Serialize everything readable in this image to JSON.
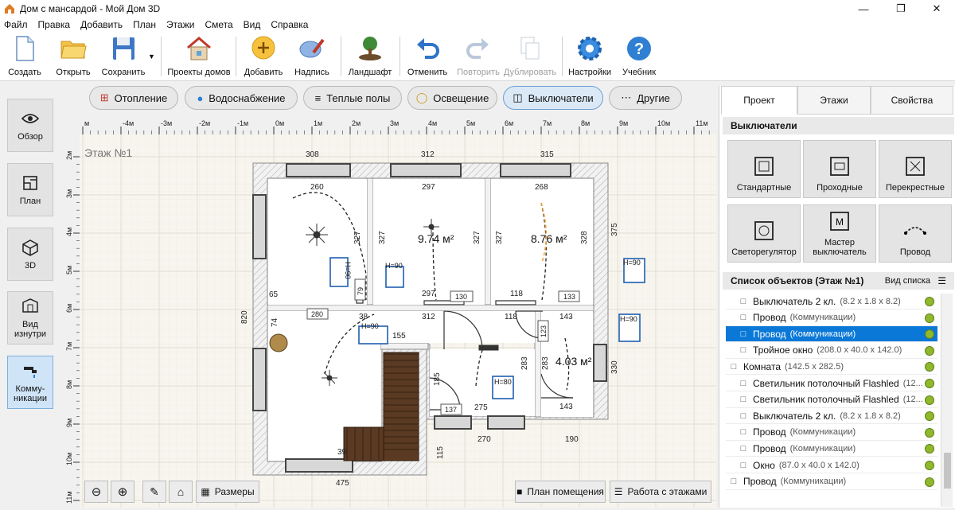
{
  "window": {
    "title": "Дом с мансардой - Мой Дом 3D"
  },
  "menu": [
    "Файл",
    "Правка",
    "Добавить",
    "План",
    "Этажи",
    "Смета",
    "Вид",
    "Справка"
  ],
  "toolbar": {
    "create": "Создать",
    "open": "Открыть",
    "save": "Сохранить",
    "projects": "Проекты домов",
    "add": "Добавить",
    "label": "Надпись",
    "landscape": "Ландшафт",
    "undo": "Отменить",
    "redo": "Повторить",
    "duplicate": "Дублировать",
    "settings": "Настройки",
    "tutorial": "Учебник"
  },
  "left_nav": {
    "overview": "Обзор",
    "plan": "План",
    "3d": "3D",
    "inside_view": "Вид изнутри",
    "communications": "Комму-никации"
  },
  "categories": {
    "heating": "Отопление",
    "water": "Водоснабжение",
    "floors": "Теплые полы",
    "lighting": "Освещение",
    "switches": "Выключатели",
    "other": "Другие"
  },
  "ruler": {
    "x_labels": [
      "м",
      "-4м",
      "-3м",
      "-2м",
      "-1м",
      "0м",
      "1м",
      "2м",
      "3м",
      "4м",
      "5м",
      "6м",
      "7м",
      "8м",
      "9м",
      "10м",
      "11м"
    ],
    "y_labels": [
      "2м",
      "3м",
      "4м",
      "5м",
      "6м",
      "7м",
      "8м",
      "9м",
      "10м",
      "11м"
    ]
  },
  "plan": {
    "floor_label": "Этаж №1",
    "dims": {
      "top1": "308",
      "top2": "312",
      "top3": "315",
      "left": "820",
      "right": "375",
      "right2": "330",
      "bottom1": "475",
      "bottom2": "270",
      "bottom3": "190",
      "r260": "260",
      "r297a": "297",
      "r268": "268",
      "v327a": "327",
      "v327b": "327",
      "v327c": "327",
      "v328": "328",
      "area1": "9.74 м²",
      "area2": "8.76 м²",
      "area3": "4.03 м²",
      "d297b": "297",
      "d130": "130",
      "d118": "118",
      "d133": "133",
      "d65": "65",
      "d280": "280",
      "d38": "38",
      "d312": "312",
      "d118b": "118",
      "d143a": "143",
      "d143b": "143",
      "d123": "123",
      "d283a": "283",
      "d283b": "283",
      "d155": "155",
      "d185": "185",
      "d137": "137",
      "d275": "275",
      "d115": "115",
      "d79": "79",
      "d74": "74",
      "d39": "39",
      "h90a": "H=90",
      "h90b": "H=90",
      "h90c": "H=90",
      "h90d": "H=90",
      "h80": "H=80",
      "h90side": "H=90"
    }
  },
  "right_panel": {
    "tabs": [
      "Проект",
      "Этажи",
      "Свойства"
    ],
    "section_title": "Выключатели",
    "tiles": [
      "Стандартные",
      "Проходные",
      "Перекрестные",
      "Светорегулятор",
      "Мастер выключатель",
      "Провод"
    ],
    "objects_title": "Список объектов (Этаж №1)",
    "list_view": "Вид списка",
    "objects": [
      {
        "name": "Выключатель 2 кл.",
        "detail": "(8.2 x 1.8 x 8.2)",
        "indent": 1
      },
      {
        "name": "Провод",
        "detail": "(Коммуникации)",
        "indent": 1
      },
      {
        "name": "Провод",
        "detail": "(Коммуникации)",
        "indent": 1,
        "selected": true
      },
      {
        "name": "Тройное окно",
        "detail": "(208.0 x 40.0 x 142.0)",
        "indent": 1
      },
      {
        "name": "Комната",
        "detail": "(142.5 x 282.5)",
        "indent": 0
      },
      {
        "name": "Светильник потолочный Flashled",
        "detail": "(12...",
        "indent": 1
      },
      {
        "name": "Светильник потолочный Flashled",
        "detail": "(12...",
        "indent": 1
      },
      {
        "name": "Выключатель 2 кл.",
        "detail": "(8.2 x 1.8 x 8.2)",
        "indent": 1
      },
      {
        "name": "Провод",
        "detail": "(Коммуникации)",
        "indent": 1
      },
      {
        "name": "Провод",
        "detail": "(Коммуникации)",
        "indent": 1
      },
      {
        "name": "Окно",
        "detail": "(87.0 x 40.0 x 142.0)",
        "indent": 1
      },
      {
        "name": "Провод",
        "detail": "(Коммуникации)",
        "indent": 0
      }
    ]
  },
  "bottom": {
    "sizes": "Размеры",
    "room_plan": "План помещения",
    "floors_work": "Работа с этажами"
  }
}
